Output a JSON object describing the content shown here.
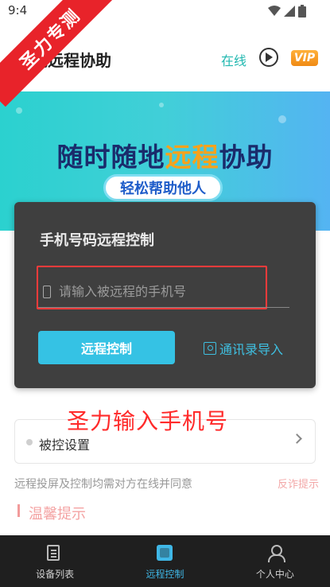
{
  "status_bar": {
    "time": "9:4"
  },
  "watermark": {
    "text": "圣力专测"
  },
  "header": {
    "title": "视远程协助",
    "online_label": "在线",
    "vip_label": "VIP"
  },
  "banner": {
    "headline_part1": "随时随地",
    "headline_highlight": "远程",
    "headline_part2": "协助",
    "subtitle": "轻松帮助他人"
  },
  "dialog": {
    "title": "手机号码远程控制",
    "phone_placeholder": "请输入被远程的手机号",
    "phone_value": "",
    "control_button": "远程控制",
    "contacts_import": "通讯录导入"
  },
  "annotation": {
    "text": "圣力输入手机号"
  },
  "settings_row": {
    "label": "被控设置"
  },
  "notice": {
    "text": "远程投屏及控制均需对方在线并同意",
    "fraud_hint": "反诈提示"
  },
  "tips": {
    "title": "温馨提示"
  },
  "bottom_nav": {
    "items": [
      {
        "label": "设备列表",
        "icon": "device-list-icon",
        "active": false
      },
      {
        "label": "远程控制",
        "icon": "remote-control-icon",
        "active": true
      },
      {
        "label": "个人中心",
        "icon": "profile-icon",
        "active": false
      }
    ]
  },
  "colors": {
    "accent": "#35c2e4",
    "online": "#22b8b0",
    "vip": "#f08a14",
    "annotation_red": "#ff2a2a",
    "nav_bg": "#1f1f1f"
  }
}
